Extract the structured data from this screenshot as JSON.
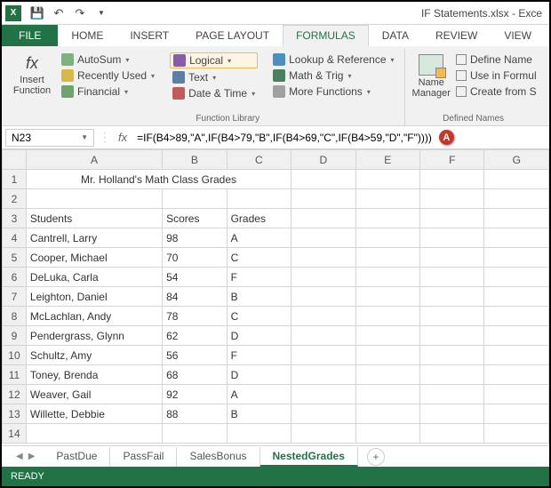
{
  "window": {
    "title": "IF Statements.xlsx - Exce"
  },
  "tabs": {
    "file": "FILE",
    "home": "HOME",
    "insert": "INSERT",
    "pagelayout": "PAGE LAYOUT",
    "formulas": "FORMULAS",
    "data": "DATA",
    "review": "REVIEW",
    "view": "VIEW"
  },
  "ribbon": {
    "insert_function": "Insert\nFunction",
    "autosum": "AutoSum",
    "recently": "Recently Used",
    "financial": "Financial",
    "logical": "Logical",
    "text": "Text",
    "datetime": "Date & Time",
    "lookup": "Lookup & Reference",
    "mathtrig": "Math & Trig",
    "morefn": "More Functions",
    "group1": "Function Library",
    "namemgr": "Name\nManager",
    "definename": "Define Name",
    "useinformula": "Use in Formul",
    "createfrom": "Create from S",
    "group2": "Defined Names"
  },
  "formula_bar": {
    "name_box": "N23",
    "formula": "=IF(B4>89,\"A\",IF(B4>79,\"B\",IF(B4>69,\"C\",IF(B4>59,\"D\",\"F\"))))",
    "marker": "A"
  },
  "sheet": {
    "columns": [
      "A",
      "B",
      "C",
      "D",
      "E",
      "F",
      "G"
    ],
    "title": "Mr. Holland's Math Class Grades",
    "header_row": 3,
    "headers": {
      "A": "Students",
      "B": "Scores",
      "C": "Grades"
    },
    "rows": [
      {
        "n": 4,
        "A": "Cantrell, Larry",
        "B": "98",
        "C": "A"
      },
      {
        "n": 5,
        "A": "Cooper, Michael",
        "B": "70",
        "C": "C"
      },
      {
        "n": 6,
        "A": "DeLuka, Carla",
        "B": "54",
        "C": "F"
      },
      {
        "n": 7,
        "A": "Leighton, Daniel",
        "B": "84",
        "C": "B"
      },
      {
        "n": 8,
        "A": "McLachlan, Andy",
        "B": "78",
        "C": "C"
      },
      {
        "n": 9,
        "A": "Pendergrass, Glynn",
        "B": "62",
        "C": "D"
      },
      {
        "n": 10,
        "A": "Schultz, Amy",
        "B": "56",
        "C": "F"
      },
      {
        "n": 11,
        "A": "Toney, Brenda",
        "B": "68",
        "C": "D"
      },
      {
        "n": 12,
        "A": "Weaver, Gail",
        "B": "92",
        "C": "A"
      },
      {
        "n": 13,
        "A": "Willette, Debbie",
        "B": "88",
        "C": "B"
      }
    ]
  },
  "sheet_tabs": [
    "PastDue",
    "PassFail",
    "SalesBonus",
    "NestedGrades"
  ],
  "active_tab": "NestedGrades",
  "status": "READY"
}
